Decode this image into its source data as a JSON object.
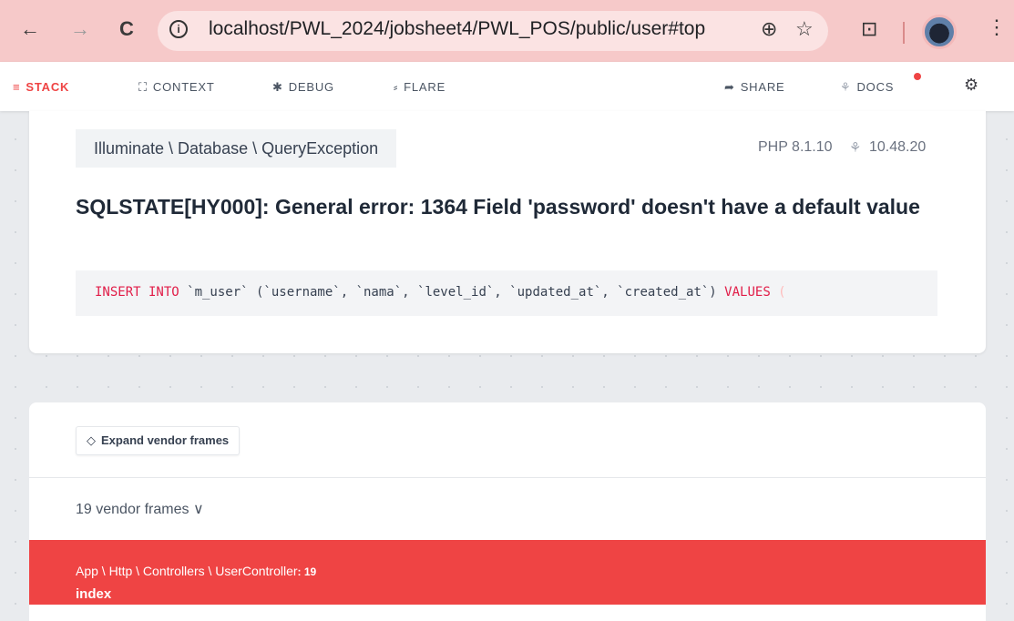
{
  "browser": {
    "url": "localhost/PWL_2024/jobsheet4/PWL_POS/public/user#top",
    "back_icon": "←",
    "forward_icon": "→",
    "reload_icon": "C",
    "info_icon": "i",
    "zoom_icon": "⊕",
    "star_icon": "☆",
    "extensions_icon": "⊡",
    "menu_icon": "⋮"
  },
  "toolbar": {
    "stack": "STACK",
    "context": "CONTEXT",
    "debug": "DEBUG",
    "flare": "FLARE",
    "share": "SHARE",
    "docs": "DOCS",
    "stack_icon": "≡",
    "context_icon": "⛶",
    "debug_icon": "✱",
    "flare_icon": "⸗",
    "share_icon": "➦",
    "docs_icon": "⚘",
    "settings_icon": "⚙",
    "accent_color": "#ef4444"
  },
  "exception": {
    "class": "Illuminate \\ Database \\ QueryException",
    "php_version": "PHP 8.1.10",
    "laravel_version": "10.48.20",
    "message": "SQLSTATE[HY000]: General error: 1364 Field 'password' doesn't have a default value",
    "sql_kw1": "INSERT INTO",
    "sql_mid": " `m_user` (`username`, `nama`, `level_id`, `updated_at`, `created_at`) ",
    "sql_kw2": "VALUES",
    "sql_tail": " ("
  },
  "stack": {
    "expand_label": "Expand vendor frames",
    "expand_icon": "◇",
    "vendor_frames": "19 vendor frames ∨",
    "active_frame": {
      "class": "App \\ Http \\ Controllers \\ UserController",
      "line": ": 19",
      "method": "index"
    }
  }
}
